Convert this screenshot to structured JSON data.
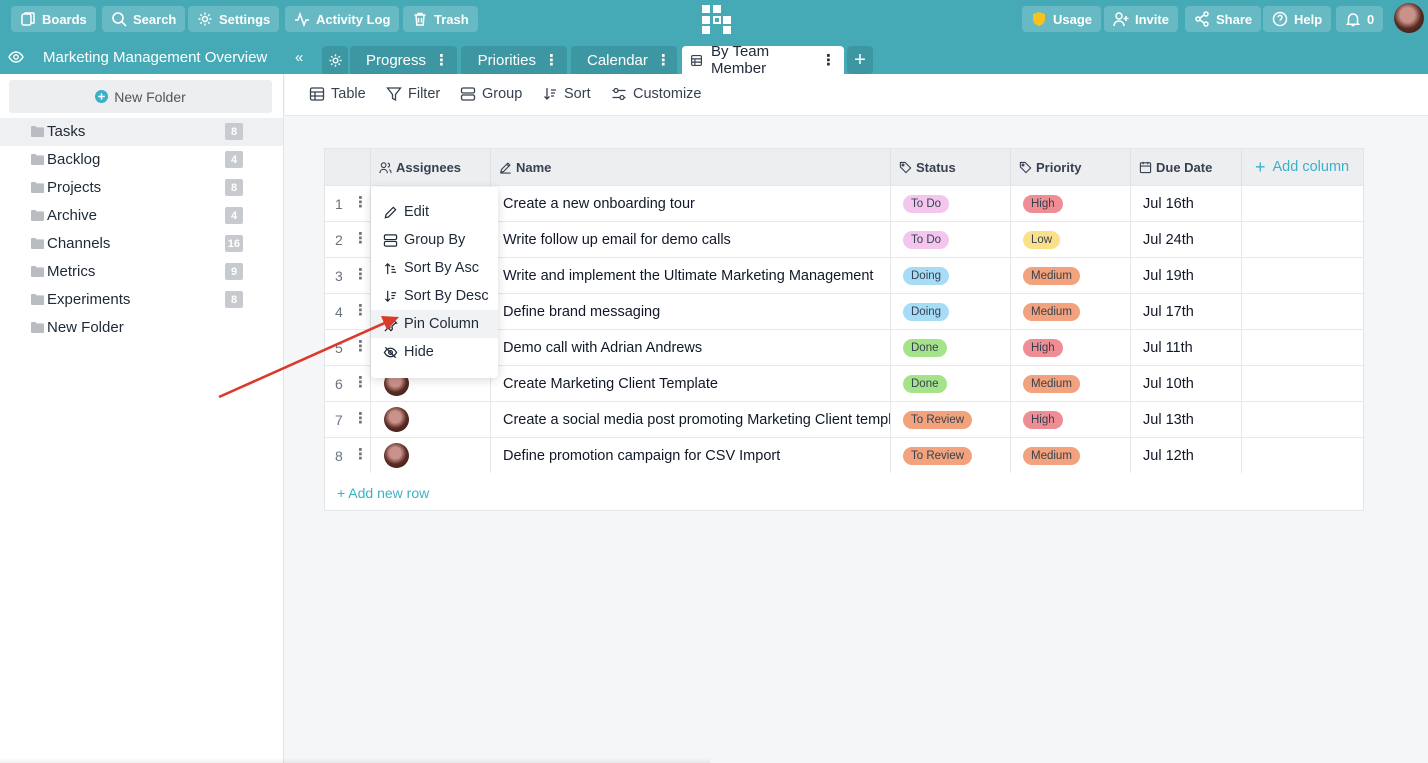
{
  "topbar": {
    "boards": "Boards",
    "search": "Search",
    "settings": "Settings",
    "activity_log": "Activity Log",
    "trash": "Trash",
    "usage": "Usage",
    "invite": "Invite",
    "share": "Share",
    "help": "Help",
    "notifications_count": "0"
  },
  "board": {
    "title": "Marketing Management Overview"
  },
  "tabs": [
    {
      "label": "Progress"
    },
    {
      "label": "Priorities"
    },
    {
      "label": "Calendar"
    },
    {
      "label": "By Team Member"
    }
  ],
  "sidebar": {
    "new_folder": "New Folder",
    "folders": [
      {
        "label": "Tasks",
        "count": "8"
      },
      {
        "label": "Backlog",
        "count": "4"
      },
      {
        "label": "Projects",
        "count": "8"
      },
      {
        "label": "Archive",
        "count": "4"
      },
      {
        "label": "Channels",
        "count": "16"
      },
      {
        "label": "Metrics",
        "count": "9"
      },
      {
        "label": "Experiments",
        "count": "8"
      },
      {
        "label": "New Folder",
        "count": ""
      }
    ]
  },
  "toolbar": {
    "table": "Table",
    "filter": "Filter",
    "group": "Group",
    "sort": "Sort",
    "customize": "Customize"
  },
  "table": {
    "headers": {
      "assignees": "Assignees",
      "name": "Name",
      "status": "Status",
      "priority": "Priority",
      "due_date": "Due Date",
      "add_column": "Add column"
    },
    "rows": [
      {
        "num": "1",
        "name": "Create a new onboarding tour",
        "status": "To Do",
        "priority": "High",
        "due": "Jul 16th"
      },
      {
        "num": "2",
        "name": "Write follow up email for demo calls",
        "status": "To Do",
        "priority": "Low",
        "due": "Jul 24th"
      },
      {
        "num": "3",
        "name": "Write and implement the Ultimate Marketing Management",
        "status": "Doing",
        "priority": "Medium",
        "due": "Jul 19th"
      },
      {
        "num": "4",
        "name": "Define brand messaging",
        "status": "Doing",
        "priority": "Medium",
        "due": "Jul 17th"
      },
      {
        "num": "5",
        "name": "Demo call with Adrian Andrews",
        "status": "Done",
        "priority": "High",
        "due": "Jul 11th"
      },
      {
        "num": "6",
        "name": "Create Marketing Client Template",
        "status": "Done",
        "priority": "Medium",
        "due": "Jul 10th"
      },
      {
        "num": "7",
        "name": "Create a social media post promoting Marketing Client template",
        "status": "To Review",
        "priority": "High",
        "due": "Jul 13th"
      },
      {
        "num": "8",
        "name": "Define promotion campaign for CSV Import",
        "status": "To Review",
        "priority": "Medium",
        "due": "Jul 12th"
      }
    ],
    "add_row": "+ Add new row"
  },
  "context_menu": {
    "items": [
      "Edit",
      "Group By",
      "Sort By Asc",
      "Sort By Desc",
      "Pin Column",
      "Hide"
    ]
  },
  "colors": {
    "brand": "#46aab6",
    "status_todo": "#f4c6ef",
    "status_doing": "#a6dcf5",
    "status_done": "#a5e38b",
    "status_review": "#f2a27c",
    "priority_high": "#ef8d94",
    "priority_low": "#fbe08a",
    "priority_medium": "#f2a27c",
    "arrow": "#d93a2b"
  }
}
